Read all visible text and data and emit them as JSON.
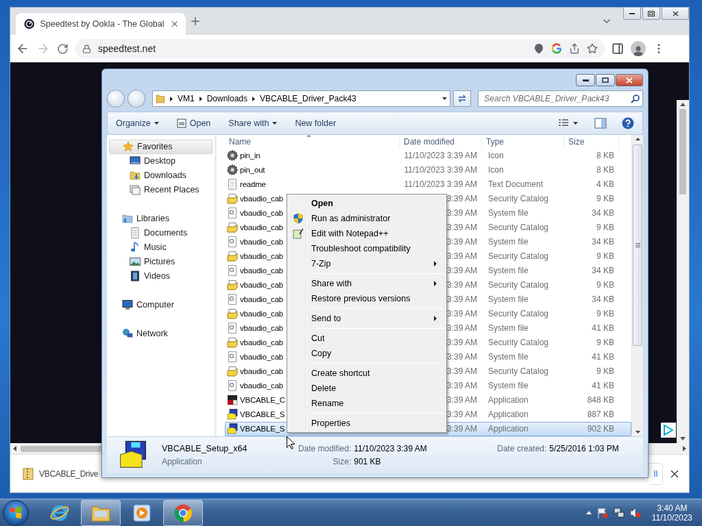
{
  "browser": {
    "tab": {
      "title": "Speedtest by Ookla - The Global"
    },
    "address": "speedtest.net",
    "download": {
      "filename": "VBCABLE_Drive",
      "show_all": "ll"
    }
  },
  "explorer": {
    "breadcrumb": [
      "VM1",
      "Downloads",
      "VBCABLE_Driver_Pack43"
    ],
    "search": {
      "placeholder": "Search VBCABLE_Driver_Pack43"
    },
    "commands": [
      {
        "label": "Organize",
        "dropdown": true,
        "kind": "plain"
      },
      {
        "label": "Open",
        "dropdown": false,
        "kind": "open"
      },
      {
        "label": "Share with",
        "dropdown": true,
        "kind": "plain"
      },
      {
        "label": "New folder",
        "dropdown": false,
        "kind": "plain"
      }
    ],
    "nav": [
      {
        "label": "Favorites",
        "kind": "star",
        "selected": true,
        "children": [
          {
            "label": "Desktop",
            "kind": "desktop",
            "selected": false
          },
          {
            "label": "Downloads",
            "kind": "downloads",
            "selected": false
          },
          {
            "label": "Recent Places",
            "kind": "recent",
            "selected": false
          }
        ]
      },
      {
        "label": "Libraries",
        "kind": "libraries",
        "selected": false,
        "children": [
          {
            "label": "Documents",
            "kind": "documents",
            "selected": false
          },
          {
            "label": "Music",
            "kind": "music",
            "selected": false
          },
          {
            "label": "Pictures",
            "kind": "pictures",
            "selected": false
          },
          {
            "label": "Videos",
            "kind": "videos",
            "selected": false
          }
        ]
      },
      {
        "label": "Computer",
        "kind": "computer",
        "selected": false
      },
      {
        "label": "Network",
        "kind": "network",
        "selected": false
      }
    ],
    "columns": [
      "Name",
      "Date modified",
      "Type",
      "Size"
    ],
    "rows": [
      {
        "name": "pin_in",
        "kind": "icon",
        "date": "11/10/2023 3:39 AM",
        "type": "Icon",
        "size": "8 KB",
        "selected": false
      },
      {
        "name": "pin_out",
        "kind": "icon",
        "date": "11/10/2023 3:39 AM",
        "type": "Icon",
        "size": "8 KB",
        "selected": false
      },
      {
        "name": "readme",
        "kind": "text",
        "date": "11/10/2023 3:39 AM",
        "type": "Text Document",
        "size": "4 KB",
        "selected": false
      },
      {
        "name": "vbaudio_cab",
        "kind": "catalog",
        "date": "3:39 AM",
        "type": "Security Catalog",
        "size": "9 KB",
        "selected": false
      },
      {
        "name": "vbaudio_cab",
        "kind": "system",
        "date": "3:39 AM",
        "type": "System file",
        "size": "34 KB",
        "selected": false
      },
      {
        "name": "vbaudio_cab",
        "kind": "catalog",
        "date": "3:39 AM",
        "type": "Security Catalog",
        "size": "9 KB",
        "selected": false
      },
      {
        "name": "vbaudio_cab",
        "kind": "system",
        "date": "3:39 AM",
        "type": "System file",
        "size": "34 KB",
        "selected": false
      },
      {
        "name": "vbaudio_cab",
        "kind": "catalog",
        "date": "3:39 AM",
        "type": "Security Catalog",
        "size": "9 KB",
        "selected": false
      },
      {
        "name": "vbaudio_cab",
        "kind": "system",
        "date": "3:39 AM",
        "type": "System file",
        "size": "34 KB",
        "selected": false
      },
      {
        "name": "vbaudio_cab",
        "kind": "catalog",
        "date": "3:39 AM",
        "type": "Security Catalog",
        "size": "9 KB",
        "selected": false
      },
      {
        "name": "vbaudio_cab",
        "kind": "system",
        "date": "3:39 AM",
        "type": "System file",
        "size": "34 KB",
        "selected": false
      },
      {
        "name": "vbaudio_cab",
        "kind": "catalog",
        "date": "3:39 AM",
        "type": "Security Catalog",
        "size": "9 KB",
        "selected": false
      },
      {
        "name": "vbaudio_cab",
        "kind": "system",
        "date": "3:39 AM",
        "type": "System file",
        "size": "41 KB",
        "selected": false
      },
      {
        "name": "vbaudio_cab",
        "kind": "catalog",
        "date": "3:39 AM",
        "type": "Security Catalog",
        "size": "9 KB",
        "selected": false
      },
      {
        "name": "vbaudio_cab",
        "kind": "system",
        "date": "3:39 AM",
        "type": "System file",
        "size": "41 KB",
        "selected": false
      },
      {
        "name": "vbaudio_cab",
        "kind": "catalog",
        "date": "3:39 AM",
        "type": "Security Catalog",
        "size": "9 KB",
        "selected": false
      },
      {
        "name": "vbaudio_cab",
        "kind": "system",
        "date": "3:39 AM",
        "type": "System file",
        "size": "41 KB",
        "selected": false
      },
      {
        "name": "VBCABLE_C",
        "kind": "app",
        "date": "3:39 AM",
        "type": "Application",
        "size": "848 KB",
        "selected": false
      },
      {
        "name": "VBCABLE_S",
        "kind": "setup",
        "date": "3:39 AM",
        "type": "Application",
        "size": "887 KB",
        "selected": false
      },
      {
        "name": "VBCABLE_S",
        "kind": "setup",
        "date": "3:39 AM",
        "type": "Application",
        "size": "902 KB",
        "selected": true
      }
    ],
    "details": {
      "name": "VBCABLE_Setup_x64",
      "type": "Application",
      "modified_label": "Date modified:",
      "modified": "11/10/2023 3:39 AM",
      "size_label": "Size:",
      "size": "901 KB",
      "created_label": "Date created:",
      "created": "5/25/2016 1:03 PM"
    }
  },
  "context_menu": {
    "groups": [
      [
        {
          "label": "Open",
          "bold": true,
          "submenu": false,
          "kind": "plain"
        },
        {
          "label": "Run as administrator",
          "bold": false,
          "submenu": false,
          "kind": "shield"
        },
        {
          "label": "Edit with Notepad++",
          "bold": false,
          "submenu": false,
          "kind": "notepad"
        },
        {
          "label": "Troubleshoot compatibility",
          "bold": false,
          "submenu": false
        },
        {
          "label": "7-Zip",
          "bold": false,
          "submenu": true
        }
      ],
      [
        {
          "label": "Share with",
          "bold": false,
          "submenu": true
        },
        {
          "label": "Restore previous versions",
          "bold": false,
          "submenu": false
        }
      ],
      [
        {
          "label": "Send to",
          "bold": false,
          "submenu": true
        }
      ],
      [
        {
          "label": "Cut",
          "bold": false,
          "submenu": false
        },
        {
          "label": "Copy",
          "bold": false,
          "submenu": false
        }
      ],
      [
        {
          "label": "Create shortcut",
          "bold": false,
          "submenu": false
        },
        {
          "label": "Delete",
          "bold": false,
          "submenu": false
        },
        {
          "label": "Rename",
          "bold": false,
          "submenu": false
        }
      ],
      [
        {
          "label": "Properties",
          "bold": false,
          "submenu": false
        }
      ]
    ]
  },
  "taskbar": {
    "apps": [
      {
        "kind": "ie",
        "running": false
      },
      {
        "kind": "folder",
        "running": true
      },
      {
        "kind": "media",
        "running": false
      },
      {
        "kind": "chrome",
        "running": true
      }
    ],
    "clock": {
      "time": "3:40 AM",
      "date": "11/10/2023"
    }
  }
}
